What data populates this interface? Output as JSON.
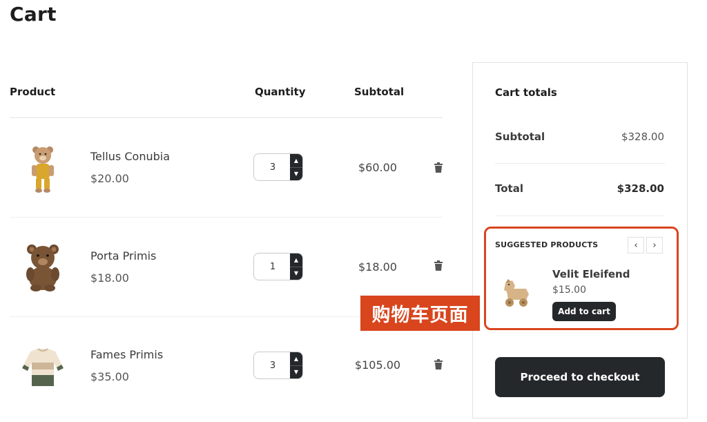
{
  "page": {
    "title": "Cart"
  },
  "table": {
    "headers": {
      "product": "Product",
      "quantity": "Quantity",
      "subtotal": "Subtotal"
    },
    "items": [
      {
        "name": "Tellus Conubia",
        "price": "$20.00",
        "qty": "3",
        "subtotal": "$60.00",
        "image": "teddy-bear-overalls-image"
      },
      {
        "name": "Porta Primis",
        "price": "$18.00",
        "qty": "1",
        "subtotal": "$18.00",
        "image": "brown-teddy-bear-image"
      },
      {
        "name": "Fames Primis",
        "price": "$35.00",
        "qty": "3",
        "subtotal": "$105.00",
        "image": "knitted-sweater-image"
      }
    ]
  },
  "totals": {
    "title": "Cart totals",
    "subtotal_label": "Subtotal",
    "subtotal_value": "$328.00",
    "total_label": "Total",
    "total_value": "$328.00"
  },
  "suggested": {
    "title": "SUGGESTED PRODUCTS",
    "prev_icon": "‹",
    "next_icon": "›",
    "product": {
      "name": "Velit Eleifend",
      "price": "$15.00",
      "image": "wooden-horse-toy-image"
    },
    "add_label": "Add to cart"
  },
  "checkout_label": "Proceed to checkout",
  "overlay_label": "购物车页面",
  "colors": {
    "accent": "#d9451d",
    "dark_button": "#25282b"
  }
}
